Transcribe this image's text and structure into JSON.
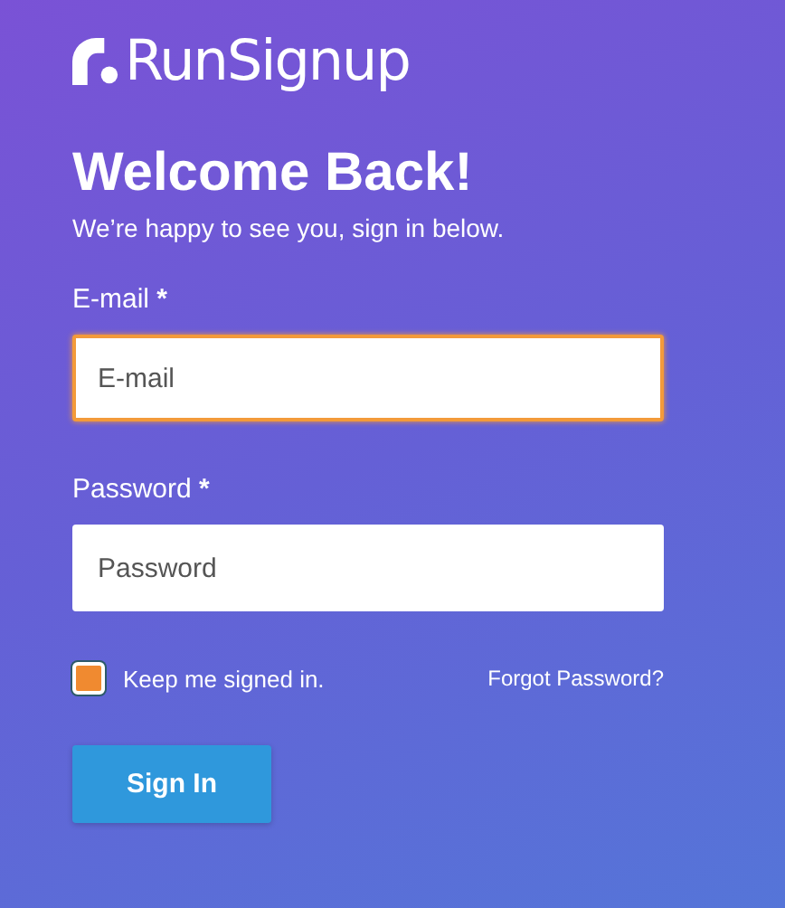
{
  "logo": {
    "text": "RunSignup"
  },
  "heading": "Welcome Back!",
  "subheading": "We’re happy to see you, sign in below.",
  "fields": [
    {
      "label": "E-mail",
      "required_mark": "*",
      "placeholder": "E-mail",
      "focused": true
    },
    {
      "label": "Password",
      "required_mark": "*",
      "placeholder": "Password",
      "focused": false
    }
  ],
  "remember": {
    "label": "Keep me signed in.",
    "checked": true
  },
  "forgot_link": "Forgot Password?",
  "submit": "Sign In"
}
